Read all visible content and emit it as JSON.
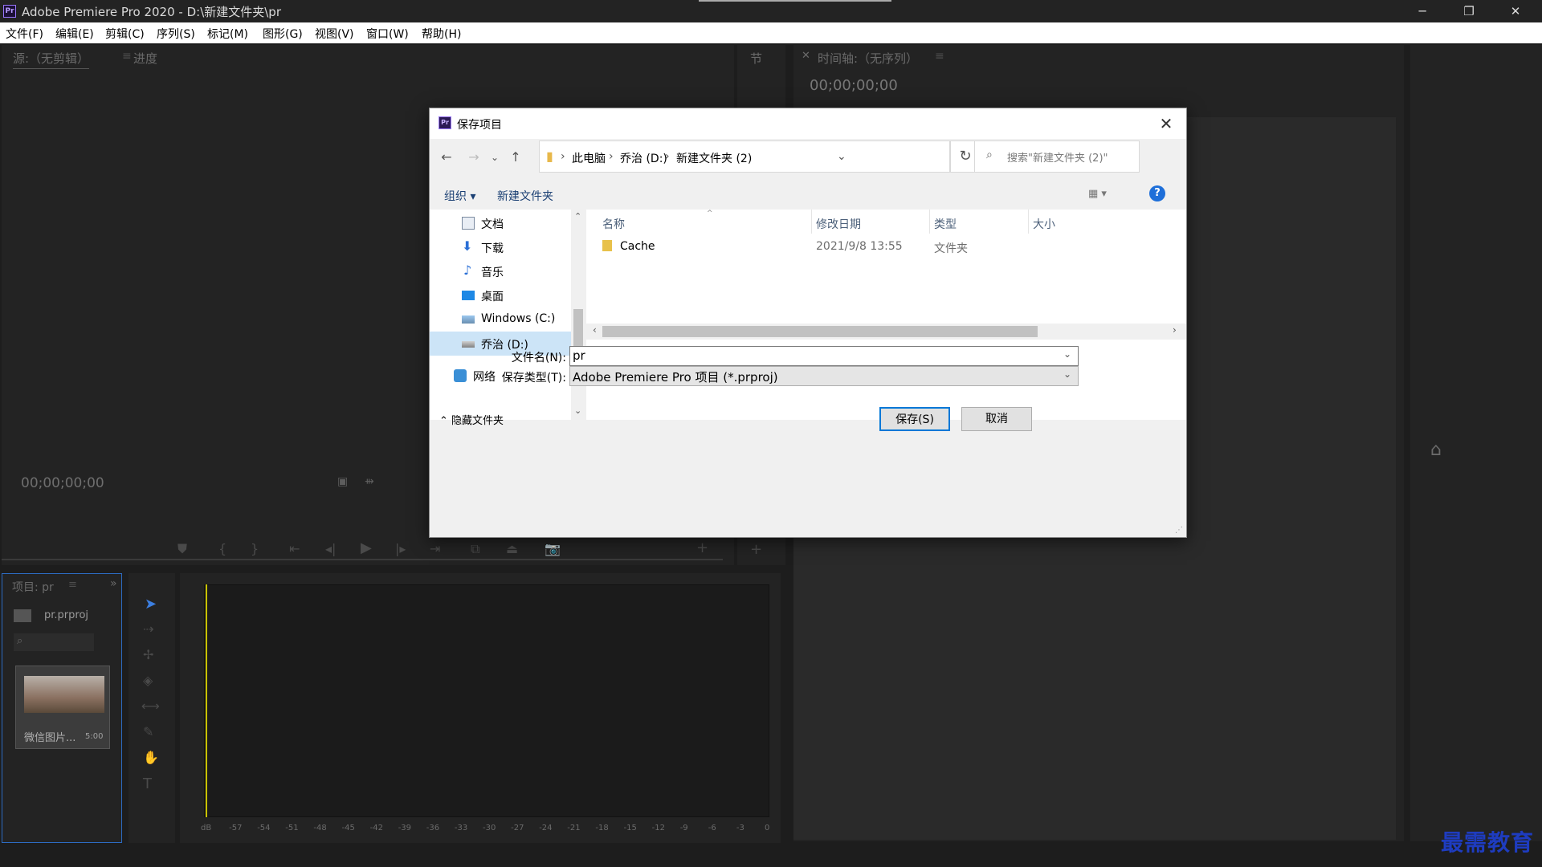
{
  "window": {
    "title": "Adobe Premiere Pro 2020 - D:\\新建文件夹\\pr",
    "logo": "Pr",
    "minimize": "─",
    "maximize": "❐",
    "close": "✕"
  },
  "menu": [
    "文件(F)",
    "编辑(E)",
    "剪辑(C)",
    "序列(S)",
    "标记(M)",
    "图形(G)",
    "视图(V)",
    "窗口(W)",
    "帮助(H)"
  ],
  "source_panel": {
    "tab_source": "源:（无剪辑）",
    "tab_progress": "进度",
    "timecode": "00;00;00;00"
  },
  "program_panel": {
    "tab_node": "节",
    "timeline_tab": "时间轴:（无序列）",
    "timecode": "00;00;00;00"
  },
  "project_panel": {
    "tab": "项目: pr",
    "file": "pr.prproj",
    "clip_name": "微信图片...",
    "clip_duration": "5:00"
  },
  "audio_meter": {
    "scale": [
      "dB",
      "-57",
      "-54",
      "-51",
      "-48",
      "-45",
      "-42",
      "-39",
      "-36",
      "-33",
      "-30",
      "-27",
      "-24",
      "-21",
      "-18",
      "-15",
      "-12",
      "-9",
      "-6",
      "-3",
      "0"
    ]
  },
  "watermark": "最需教育",
  "dialog": {
    "title": "保存项目",
    "icon": "Pr",
    "breadcrumb": [
      "此电脑",
      "乔治 (D:)",
      "新建文件夹 (2)"
    ],
    "search_placeholder": "搜索\"新建文件夹 (2)\"",
    "toolbar": {
      "organize": "组织 ▾",
      "new_folder": "新建文件夹",
      "help": "?"
    },
    "nav_items": [
      {
        "label": "文档",
        "icon": "document-icon"
      },
      {
        "label": "下载",
        "icon": "download-icon"
      },
      {
        "label": "音乐",
        "icon": "music-icon"
      },
      {
        "label": "桌面",
        "icon": "desktop-icon"
      },
      {
        "label": "Windows (C:)",
        "icon": "drive-icon"
      },
      {
        "label": "乔治 (D:)",
        "icon": "drive-icon"
      },
      {
        "label": "网络",
        "icon": "network-icon"
      }
    ],
    "columns": {
      "name": "名称",
      "date": "修改日期",
      "type": "类型",
      "size": "大小"
    },
    "files": [
      {
        "name": "Cache",
        "date": "2021/9/8 13:55",
        "type": "文件夹",
        "size": ""
      }
    ],
    "filename_label": "文件名(N):",
    "filename_value": "pr",
    "filetype_label": "保存类型(T):",
    "filetype_value": "Adobe Premiere Pro 项目 (*.prproj)",
    "hide_folders": "隐藏文件夹",
    "save_button": "保存(S)",
    "cancel_button": "取消"
  }
}
